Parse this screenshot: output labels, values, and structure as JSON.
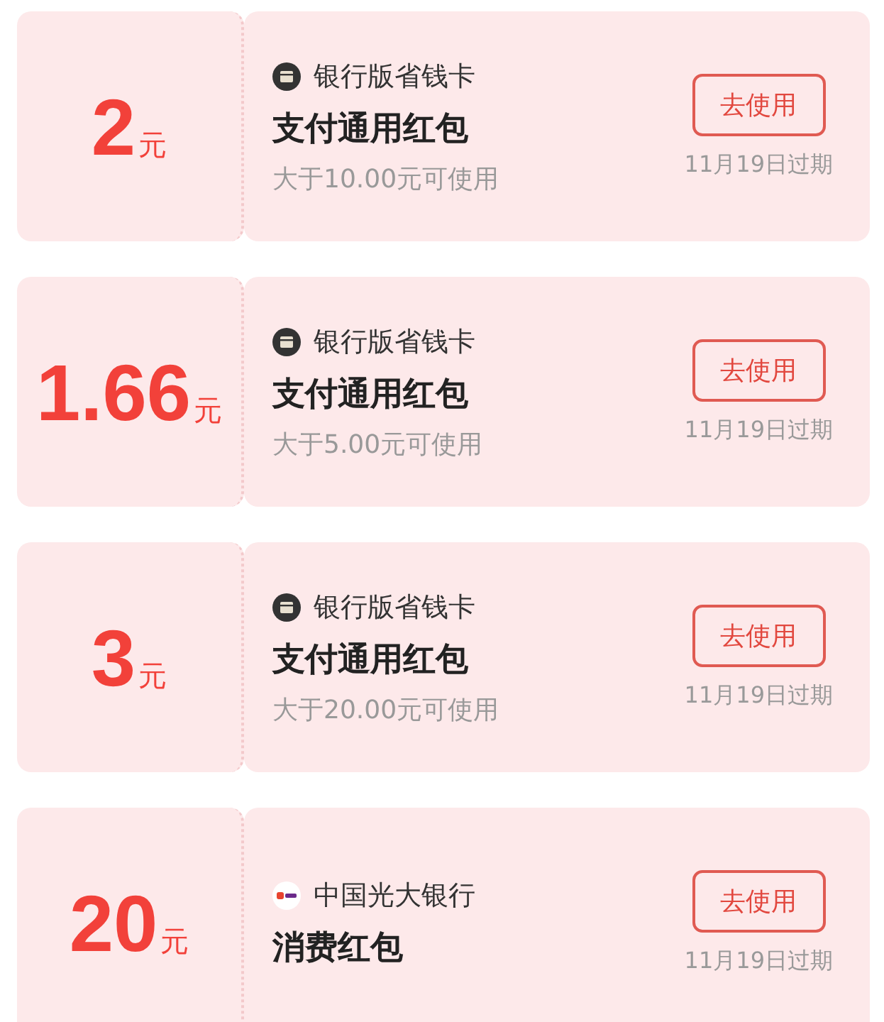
{
  "coupons": [
    {
      "amount": "2",
      "unit": "元",
      "issuer": {
        "kind": "wallet",
        "name": "银行版省钱卡"
      },
      "title": "支付通用红包",
      "condition": "大于10.00元可使用",
      "button": "去使用",
      "expiry": "11月19日过期"
    },
    {
      "amount": "1.66",
      "unit": "元",
      "issuer": {
        "kind": "wallet",
        "name": "银行版省钱卡"
      },
      "title": "支付通用红包",
      "condition": "大于5.00元可使用",
      "button": "去使用",
      "expiry": "11月19日过期"
    },
    {
      "amount": "3",
      "unit": "元",
      "issuer": {
        "kind": "wallet",
        "name": "银行版省钱卡"
      },
      "title": "支付通用红包",
      "condition": "大于20.00元可使用",
      "button": "去使用",
      "expiry": "11月19日过期"
    },
    {
      "amount": "20",
      "unit": "元",
      "issuer": {
        "kind": "bank",
        "name": "中国光大银行"
      },
      "title": "消费红包",
      "button": "去使用",
      "expiry": "11月19日过期"
    }
  ]
}
